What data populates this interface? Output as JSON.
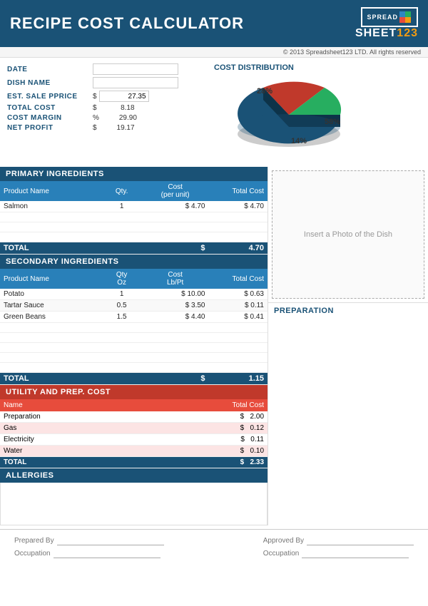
{
  "header": {
    "title": "RECIPE COST CALCULATOR",
    "logo_top": "SPREAD",
    "logo_brand": "SHEET",
    "logo_num": "123"
  },
  "copyright": "© 2013 Spreadsheet123 LTD. All rights reserved",
  "fields": {
    "date_label": "DATE",
    "dish_name_label": "DISH NAME",
    "est_sale_label": "EST. SALE PPRICE",
    "total_cost_label": "TOTAL COST",
    "cost_margin_label": "COST MARGIN",
    "net_profit_label": "NET PROFIT",
    "est_sale_prefix": "$",
    "est_sale_value": "27.35",
    "total_cost_prefix": "$",
    "total_cost_value": "8.18",
    "cost_margin_prefix": "%",
    "cost_margin_value": "29.90",
    "net_profit_prefix": "$",
    "net_profit_value": "19.17"
  },
  "chart": {
    "title": "COST DISTRIBUTION",
    "slices": [
      {
        "label": "58%",
        "color": "#1a5276",
        "value": 58
      },
      {
        "label": "28%",
        "color": "#c0392b",
        "value": 28
      },
      {
        "label": "14%",
        "color": "#27ae60",
        "value": 14
      }
    ]
  },
  "primary_ingredients": {
    "section_title": "PRIMARY INGREDIENTS",
    "headers": [
      "Product Name",
      "Qty.",
      "Cost\n(per unit)",
      "Total Cost"
    ],
    "rows": [
      {
        "name": "Salmon",
        "qty": "1",
        "cost_prefix": "$",
        "cost": "4.70",
        "total_prefix": "$",
        "total": "4.70"
      },
      {
        "name": "",
        "qty": "",
        "cost_prefix": "",
        "cost": "",
        "total_prefix": "",
        "total": ""
      },
      {
        "name": "",
        "qty": "",
        "cost_prefix": "",
        "cost": "",
        "total_prefix": "",
        "total": ""
      },
      {
        "name": "",
        "qty": "",
        "cost_prefix": "",
        "cost": "",
        "total_prefix": "",
        "total": ""
      }
    ],
    "total_label": "TOTAL",
    "total_prefix": "$",
    "total_value": "4.70"
  },
  "secondary_ingredients": {
    "section_title": "SECONDARY INGREDIENTS",
    "headers": [
      "Product Name",
      "Qty\nOz",
      "Cost\nLb/Pt",
      "Total Cost"
    ],
    "rows": [
      {
        "name": "Potato",
        "qty": "1",
        "cost_prefix": "$",
        "cost": "10.00",
        "total_prefix": "$",
        "total": "0.63"
      },
      {
        "name": "Tartar Sauce",
        "qty": "0.5",
        "cost_prefix": "$",
        "cost": "3.50",
        "total_prefix": "$",
        "total": "0.11"
      },
      {
        "name": "Green Beans",
        "qty": "1.5",
        "cost_prefix": "$",
        "cost": "4.40",
        "total_prefix": "$",
        "total": "0.41"
      },
      {
        "name": "",
        "qty": "",
        "cost_prefix": "",
        "cost": "",
        "total_prefix": "",
        "total": ""
      },
      {
        "name": "",
        "qty": "",
        "cost_prefix": "",
        "cost": "",
        "total_prefix": "",
        "total": ""
      },
      {
        "name": "",
        "qty": "",
        "cost_prefix": "",
        "cost": "",
        "total_prefix": "",
        "total": ""
      },
      {
        "name": "",
        "qty": "",
        "cost_prefix": "",
        "cost": "",
        "total_prefix": "",
        "total": ""
      },
      {
        "name": "",
        "qty": "",
        "cost_prefix": "",
        "cost": "",
        "total_prefix": "",
        "total": ""
      }
    ],
    "total_label": "TOTAL",
    "total_prefix": "$",
    "total_value": "1.15"
  },
  "utility": {
    "section_title": "UTILITY AND PREP. COST",
    "headers": [
      "Name",
      "",
      "Total Cost"
    ],
    "rows": [
      {
        "name": "Preparation",
        "total_prefix": "$",
        "total": "2.00"
      },
      {
        "name": "Gas",
        "total_prefix": "$",
        "total": "0.12"
      },
      {
        "name": "Electricity",
        "total_prefix": "$",
        "total": "0.11"
      },
      {
        "name": "Water",
        "total_prefix": "$",
        "total": "0.10"
      }
    ],
    "total_label": "TOTAL",
    "total_prefix": "$",
    "total_value": "2.33"
  },
  "right_panel": {
    "photo_placeholder": "Insert a Photo of the Dish",
    "prep_title": "PREPARATION"
  },
  "allergies": {
    "section_title": "ALLERGIES"
  },
  "footer": {
    "prepared_by_label": "Prepared By",
    "approved_by_label": "Approved By",
    "occupation_label1": "Occupation",
    "occupation_label2": "Occupation"
  }
}
